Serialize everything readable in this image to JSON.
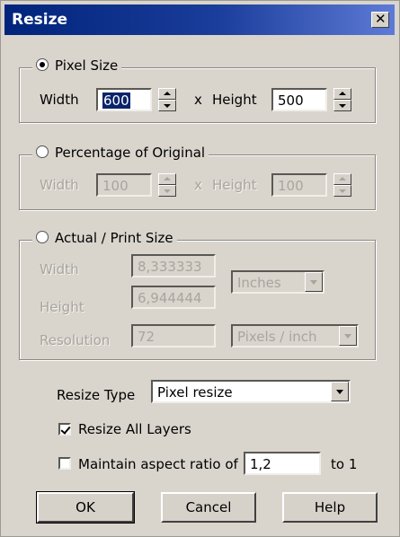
{
  "window": {
    "title": "Resize"
  },
  "pixel_size": {
    "legend": "Pixel Size",
    "selected": true,
    "width_label": "Width",
    "width_value": "600",
    "x_label": "x",
    "height_label": "Height",
    "height_value": "500"
  },
  "percentage": {
    "legend": "Percentage of Original",
    "selected": false,
    "width_label": "Width",
    "width_value": "100",
    "x_label": "x",
    "height_label": "Height",
    "height_value": "100"
  },
  "actual": {
    "legend": "Actual / Print Size",
    "selected": false,
    "width_label": "Width",
    "width_value": "8,333333",
    "height_label": "Height",
    "height_value": "6,944444",
    "resolution_label": "Resolution",
    "resolution_value": "72",
    "units_value": "Inches",
    "res_units_value": "Pixels / inch"
  },
  "resize_type": {
    "label": "Resize Type",
    "value": "Pixel resize"
  },
  "resize_all_layers": {
    "label": "Resize All Layers",
    "checked": true
  },
  "aspect": {
    "label": "Maintain aspect ratio of",
    "value": "1,2",
    "suffix": "to 1",
    "checked": false
  },
  "buttons": {
    "ok": "OK",
    "cancel": "Cancel",
    "help": "Help"
  },
  "colors": {
    "title_bar": "#00247b",
    "dialog_bg": "#d9d5cd",
    "selection": "#0a246a"
  }
}
